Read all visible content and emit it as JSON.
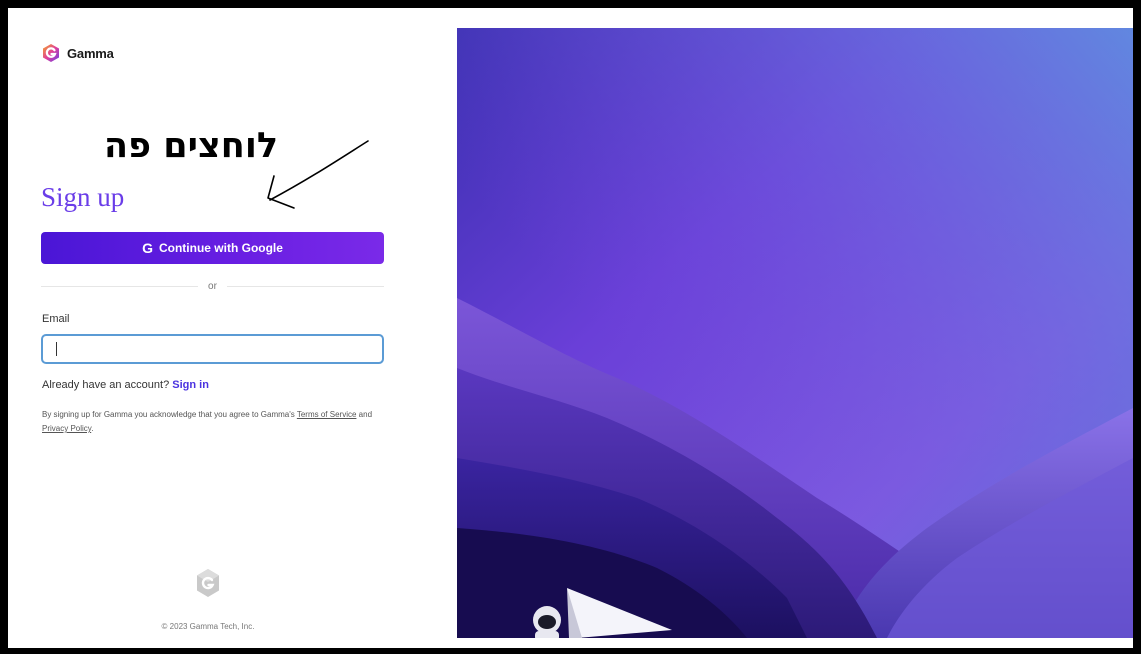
{
  "brand": {
    "name": "Gamma",
    "accent_color": "#6a3de8",
    "button_color": "#5b1ee0",
    "link_color": "#4a32e0"
  },
  "annotation": {
    "text": "לוחצים פה",
    "arrow_icon": "hand-drawn-arrow-icon"
  },
  "signup": {
    "title": "Sign up",
    "google_icon": "G",
    "google_button_label": "Continue with Google",
    "divider_text": "or",
    "email_label": "Email",
    "email_value": "",
    "email_placeholder": "",
    "already_text": "Already have an account?",
    "signin_link": "Sign in",
    "legal_prefix": "By signing up for Gamma you acknowledge that you agree to Gamma's",
    "terms_link": "Terms of Service",
    "legal_and": "and",
    "privacy_link": "Privacy Policy",
    "legal_suffix": "."
  },
  "footer": {
    "logo_icon": "gamma-g-icon",
    "copyright": "© 2023 Gamma Tech, Inc."
  },
  "illustration": {
    "description_icon": "mountains-astronaut-illustration"
  }
}
